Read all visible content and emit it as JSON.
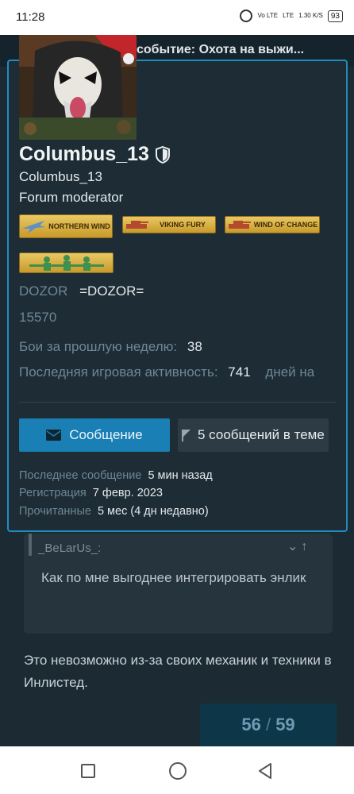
{
  "status_bar": {
    "time": "11:28",
    "signal1": "Vo LTE",
    "signal2": "LTE",
    "speed": "1.30 K/S",
    "battery": "93"
  },
  "topic": {
    "title": "событие: Охота на выжи..."
  },
  "profile": {
    "username": "Columbus_13",
    "display_name": "Columbus_13",
    "role": "Forum moderator",
    "badges": [
      {
        "label": "NORTHERN WIND",
        "icon": "plane-icon"
      },
      {
        "label": "VIKING FURY",
        "icon": "tank-icon"
      },
      {
        "label": "WIND OF CHANGE",
        "icon": "tank-icon"
      },
      {
        "label": "",
        "icon": "soldiers-icon"
      }
    ],
    "clan_tag": "DOZOR",
    "clan_name": "=DOZOR=",
    "rating": "15570",
    "battles_label": "Бои за прошлую неделю:",
    "battles_value": "38",
    "activity_label": "Последняя игровая активность:",
    "activity_value": "741",
    "activity_unit": "дней на",
    "message_button": "Сообщение",
    "posts_button": "5 сообщений в теме",
    "last_post_label": "Последнее сообщение",
    "last_post_value": "5 мин назад",
    "registered_label": "Регистрация",
    "registered_value": "7 февр. 2023",
    "read_label": "Прочитанные",
    "read_value": "5 мес (4 дн недавно)"
  },
  "post": {
    "quote_author": "_BeLarUs_:",
    "quote_text": "Как по мне выгоднее интегрировать энлик",
    "text": "Это невозможно из-за своих механик и техники в Инлистед."
  },
  "progress": {
    "current": "56",
    "separator": "/",
    "total": "59"
  },
  "colors": {
    "accent": "#1f8cc0",
    "button": "#1a7fb4",
    "card_bg": "#1d2c35",
    "page_bg": "#1c2a33"
  }
}
